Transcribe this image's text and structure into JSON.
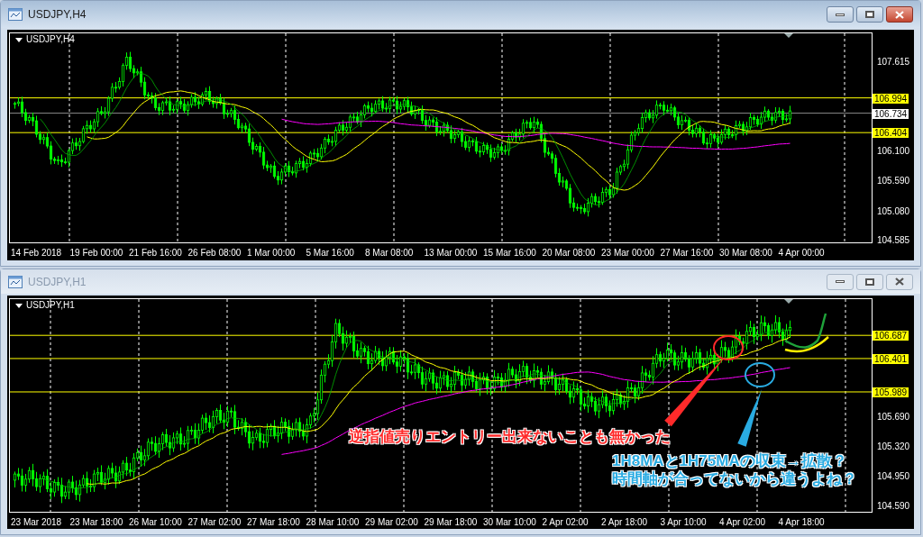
{
  "windows": [
    {
      "title": "USDJPY,H4",
      "active": true,
      "chart_label": "USDJPY,H4",
      "price_axis": [
        "107.615",
        "106.100",
        "105.590",
        "105.080",
        "104.585"
      ],
      "price_lines": [
        {
          "label": "106.994",
          "kind": "level"
        },
        {
          "label": "106.734",
          "kind": "bid"
        },
        {
          "label": "106.404",
          "kind": "level"
        }
      ],
      "time_axis": [
        "14 Feb 2018",
        "19 Feb 00:00",
        "21 Feb 16:00",
        "26 Feb 08:00",
        "1 Mar 00:00",
        "5 Mar 16:00",
        "8 Mar 08:00",
        "13 Mar 00:00",
        "15 Mar 16:00",
        "20 Mar 08:00",
        "23 Mar 00:00",
        "27 Mar 16:00",
        "30 Mar 08:00",
        "4 Apr 00:00"
      ]
    },
    {
      "title": "USDJPY,H1",
      "active": false,
      "chart_label": "USDJPY,H1",
      "price_axis": [
        "105.690",
        "105.320",
        "104.950",
        "104.590"
      ],
      "price_lines": [
        {
          "label": "106.687",
          "kind": "level"
        },
        {
          "label": "106.401",
          "kind": "level"
        },
        {
          "label": "105.989",
          "kind": "level"
        }
      ],
      "time_axis": [
        "23 Mar 2018",
        "23 Mar 18:00",
        "26 Mar 10:00",
        "27 Mar 02:00",
        "27 Mar 18:00",
        "28 Mar 10:00",
        "29 Mar 02:00",
        "29 Mar 18:00",
        "30 Mar 10:00",
        "2 Apr 02:00",
        "2 Apr 18:00",
        "3 Apr 10:00",
        "4 Apr 02:00",
        "4 Apr 18:00"
      ],
      "annotations": [
        {
          "kind": "callout",
          "color": "#ff2a2a",
          "lines": [
            "逆指値売りエントリー出来ないことも無かった"
          ]
        },
        {
          "kind": "callout",
          "color": "#29abe2",
          "lines": [
            "1H8MAと1H75MAの収束→拡散？",
            "時間軸が合ってないから違うよね？"
          ]
        }
      ]
    }
  ]
}
